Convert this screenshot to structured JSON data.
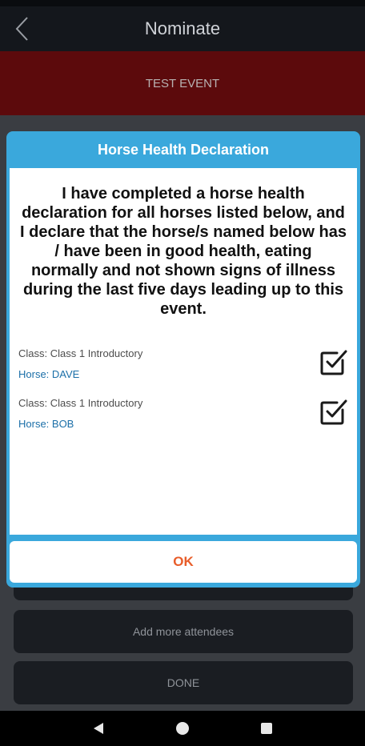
{
  "header": {
    "title": "Nominate"
  },
  "event": {
    "name": "TEST EVENT"
  },
  "background_buttons": {
    "add_more": "Add more attendees",
    "done": "DONE"
  },
  "modal": {
    "title": "Horse Health Declaration",
    "declaration": "I have completed a horse health declaration for all horses listed below, and I declare that the horse/s named below has / have been in good health, eating normally and not shown signs of illness during the last five days leading up to this event.",
    "entries": [
      {
        "class_label": "Class: Class 1 Introductory",
        "horse_label": "Horse: DAVE",
        "checked": true
      },
      {
        "class_label": "Class: Class 1 Introductory",
        "horse_label": "Horse: BOB",
        "checked": true
      }
    ],
    "ok_label": "OK"
  },
  "colors": {
    "modal_accent": "#3aa8dc",
    "ok_text": "#e85d2a",
    "horse_link": "#1b6fa8",
    "event_banner": "#5c0a0c"
  },
  "icons": {
    "back": "chevron-left-icon",
    "checkbox": "checkbox-checked-icon",
    "nav": [
      "back-triangle-icon",
      "home-circle-icon",
      "recents-square-icon"
    ]
  }
}
